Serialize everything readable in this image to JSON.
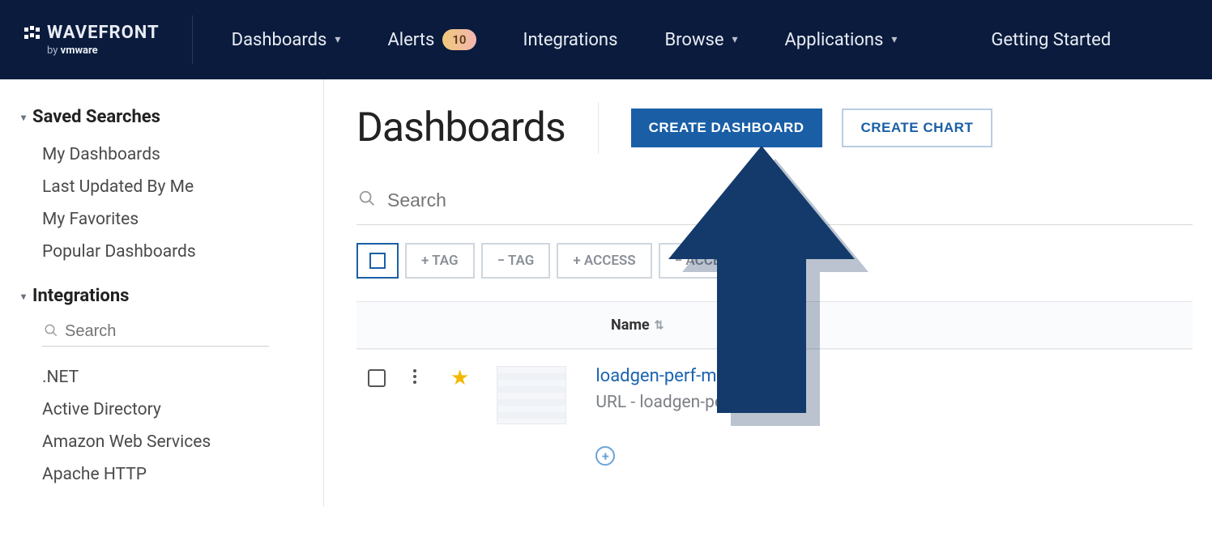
{
  "brand": {
    "name": "WAVEFRONT",
    "byline_prefix": "by ",
    "byline_brand": "vmware"
  },
  "nav": {
    "dashboards": "Dashboards",
    "alerts": "Alerts",
    "alerts_badge": "10",
    "integrations": "Integrations",
    "browse": "Browse",
    "applications": "Applications",
    "getting_started": "Getting Started"
  },
  "sidebar": {
    "saved_searches": {
      "title": "Saved Searches",
      "items": [
        "My Dashboards",
        "Last Updated By Me",
        "My Favorites",
        "Popular Dashboards"
      ]
    },
    "integrations": {
      "title": "Integrations",
      "search_placeholder": "Search",
      "items": [
        ".NET",
        "Active Directory",
        "Amazon Web Services",
        "Apache HTTP"
      ]
    }
  },
  "main": {
    "title": "Dashboards",
    "create_dashboard": "CREATE DASHBOARD",
    "create_chart": "CREATE CHART",
    "search_placeholder": "Search",
    "chips": {
      "tag_add": "+ TAG",
      "tag_remove": "− TAG",
      "access_add": "+ ACCESS",
      "access_remove": "− ACCESS"
    },
    "columns": {
      "name": "Name"
    },
    "rows": [
      {
        "name": "loadgen-perf-metrics",
        "url_label": "URL - loadgen-perf-metrics",
        "favorite": true
      }
    ]
  }
}
